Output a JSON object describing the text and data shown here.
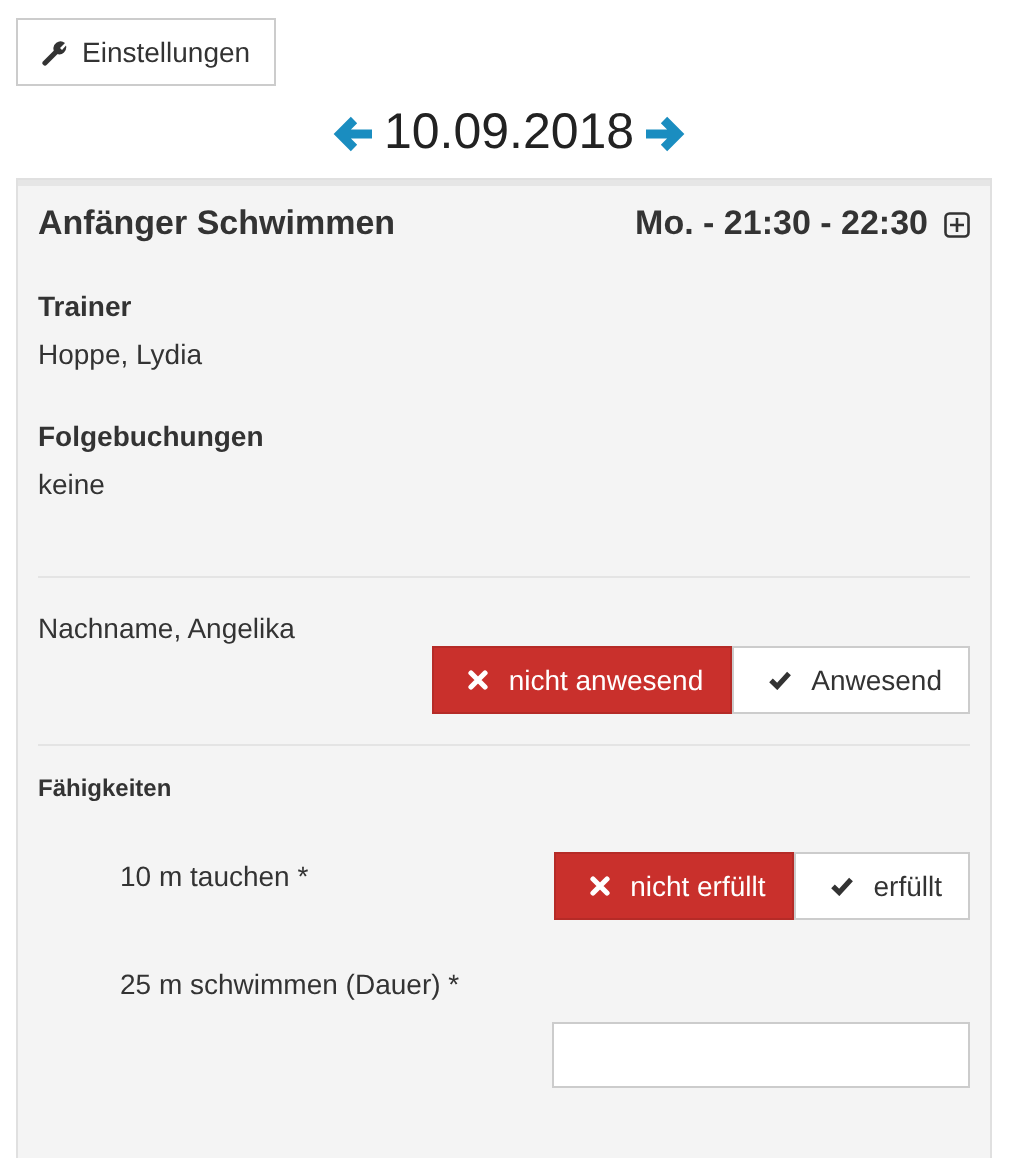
{
  "settings_button": {
    "label": "Einstellungen"
  },
  "date_nav": {
    "date": "10.09.2018"
  },
  "course": {
    "title": "Anfänger Schwimmen",
    "time": "Mo. - 21:30 - 22:30",
    "details": [
      {
        "label": "Trainer",
        "value": "Hoppe, Lydia"
      },
      {
        "label": "Folgebuchungen",
        "value": "keine"
      }
    ],
    "participant": {
      "name": "Nachname, Angelika",
      "options": [
        {
          "label": "nicht anwesend",
          "kind": "no",
          "selected": true
        },
        {
          "label": "Anwesend",
          "kind": "yes",
          "selected": false
        }
      ]
    },
    "skills_heading": "Fähigkeiten",
    "skills": [
      {
        "kind": "toggle",
        "label": "10 m tauchen *",
        "options": [
          {
            "label": "nicht erfüllt",
            "kind": "no",
            "selected": true
          },
          {
            "label": "erfüllt",
            "kind": "yes",
            "selected": false
          }
        ]
      },
      {
        "kind": "input",
        "label": "25 m schwimmen (Dauer) *"
      }
    ]
  }
}
